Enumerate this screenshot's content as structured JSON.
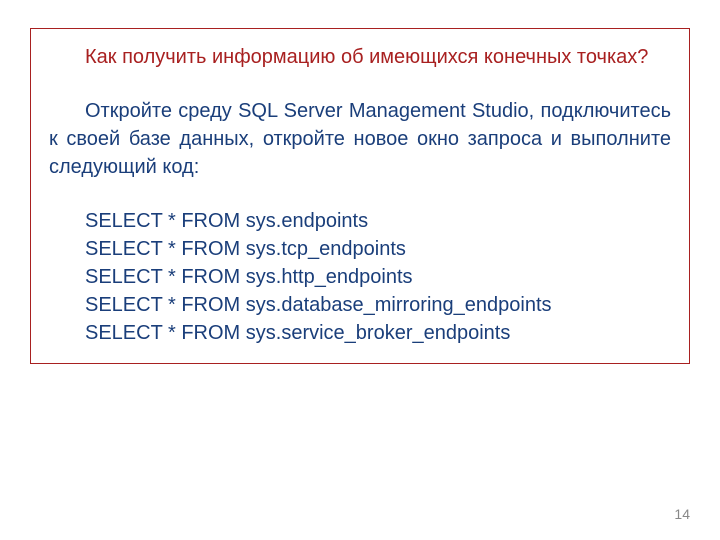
{
  "question": "Как получить информацию об имеющихся конечных точках?",
  "instruction": "Откройте среду SQL Server Management Studio, подключитесь к своей базе данных, откройте новое окно запроса и выполните следующий код:",
  "code": {
    "line1": "SELECT * FROM sys.endpoints",
    "line2": "SELECT * FROM sys.tcp_endpoints",
    "line3": "SELECT * FROM sys.http_endpoints",
    "line4": "SELECT * FROM sys.database_mirroring_endpoints",
    "line5": "SELECT * FROM sys.service_broker_endpoints"
  },
  "page_number": "14"
}
